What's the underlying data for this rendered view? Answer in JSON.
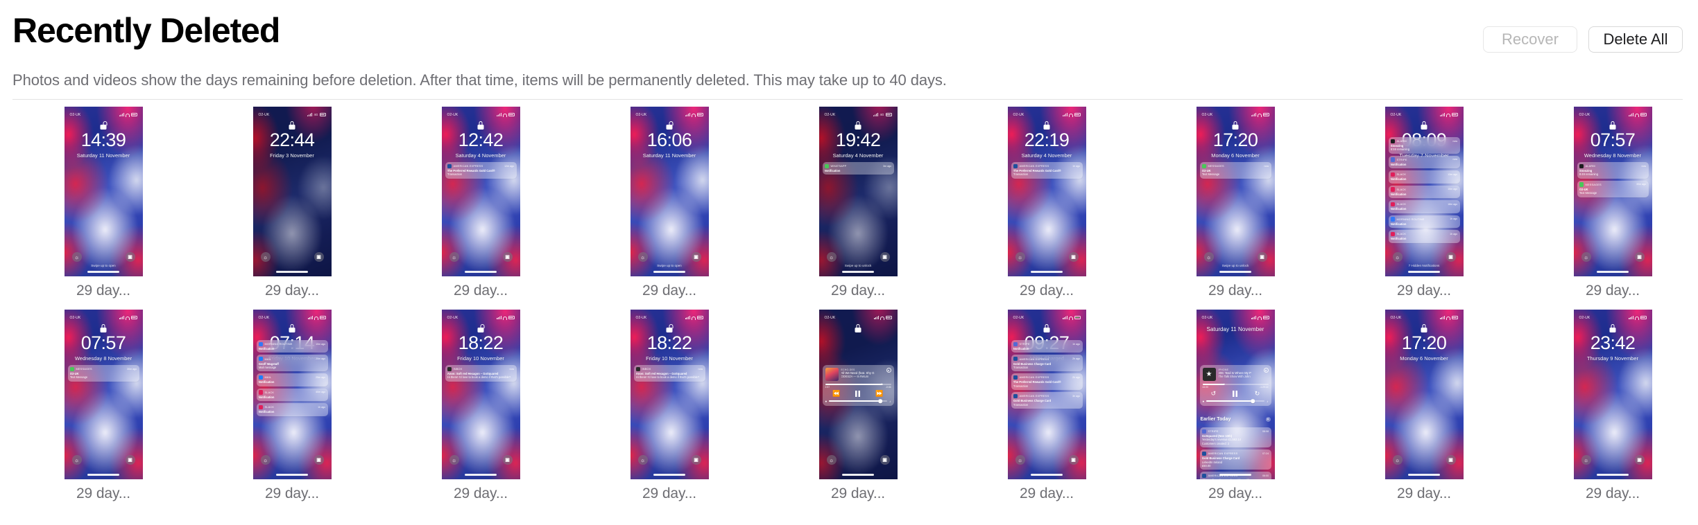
{
  "header": {
    "title": "Recently Deleted",
    "subtitle": "Photos and videos show the days remaining before deletion. After that time, items will be permanently deleted. This may take up to 40 days.",
    "recover_label": "Recover",
    "recover_disabled": true,
    "delete_all_label": "Delete All"
  },
  "colors": {
    "title": "#000000",
    "subtitle": "#6e6e73",
    "button_border": "#d8d8d8",
    "button_disabled_text": "#b6b6b6",
    "divider": "#e2e2e2",
    "caption": "#6e6e73",
    "background": "#ffffff"
  },
  "grid": {
    "columns": 9,
    "rows": 2,
    "items": [
      {
        "caption": "29 day...",
        "carrier": "O2-UK",
        "signal": "bars",
        "network": "wifi",
        "battery": "full",
        "time": "14:39",
        "date": "Saturday 11 November",
        "lock": "unlocked",
        "theme": "light",
        "swipe_hint": "Swipe up to open",
        "notifications": []
      },
      {
        "caption": "29 day...",
        "carrier": "O2-UK",
        "signal": "bars",
        "network": "4G",
        "battery": "full",
        "time": "22:44",
        "date": "Friday 3 November",
        "lock": "locked",
        "theme": "dark",
        "swipe_hint": "",
        "notifications": []
      },
      {
        "caption": "29 day...",
        "carrier": "O2-UK",
        "signal": "bars",
        "network": "wifi",
        "battery": "full",
        "time": "12:42",
        "date": "Saturday 4 November",
        "lock": "locked",
        "theme": "light",
        "swipe_hint": "",
        "notifications": [
          {
            "app": "AMERICAN EXPRESS",
            "ago": "12m ago",
            "line1": "The Preferred Rewards Gold Card®",
            "line2": "Transaction",
            "icon_color": "#1e4f9c"
          }
        ]
      },
      {
        "caption": "29 day...",
        "carrier": "O2-UK",
        "signal": "bars",
        "network": "wifi",
        "battery": "full",
        "time": "16:06",
        "date": "Saturday 11 November",
        "lock": "unlocked",
        "theme": "light",
        "swipe_hint": "Swipe up to open",
        "notifications": []
      },
      {
        "caption": "29 day...",
        "carrier": "O2-UK",
        "signal": "bars",
        "network": "4G",
        "battery": "full",
        "time": "19:42",
        "date": "Saturday 4 November",
        "lock": "locked",
        "theme": "dark",
        "swipe_hint": "Swipe up to unlock",
        "notifications": [
          {
            "app": "WHATSAPP",
            "ago": "3m ago",
            "line1": "Notification",
            "line2": "",
            "icon_color": "#4ac759"
          }
        ]
      },
      {
        "caption": "29 day...",
        "carrier": "O2-UK",
        "signal": "bars",
        "network": "wifi",
        "battery": "full",
        "time": "22:19",
        "date": "Saturday 4 November",
        "lock": "locked",
        "theme": "light",
        "swipe_hint": "",
        "notifications": [
          {
            "app": "AMERICAN EXPRESS",
            "ago": "1h ago",
            "line1": "The Preferred Rewards Gold Card®",
            "line2": "Transaction",
            "icon_color": "#1e4f9c"
          }
        ]
      },
      {
        "caption": "29 day...",
        "carrier": "O2-UK",
        "signal": "bars",
        "network": "wifi",
        "battery": "full",
        "time": "17:20",
        "date": "Monday 6 November",
        "lock": "locked",
        "theme": "light",
        "swipe_hint": "Swipe up to unlock",
        "notifications": [
          {
            "app": "MESSAGES",
            "ago": "now",
            "line1": "O2-UK",
            "line2": "Text Message",
            "icon_color": "#4ac759"
          }
        ]
      },
      {
        "caption": "29 day...",
        "carrier": "O2-UK",
        "signal": "bars",
        "network": "wifi",
        "battery": "full",
        "time": "08:09",
        "date": "Tuesday 7 November",
        "lock": "locked",
        "theme": "light",
        "swipe_hint": "7 Hidden Notifications",
        "notifications": [
          {
            "app": "ALARM",
            "ago": "now",
            "line1": "Snoozing",
            "line2": "8:59 remaining",
            "icon_color": "#1c1c1e"
          },
          {
            "app": "STRIPE",
            "ago": "now",
            "line1": "Notification",
            "line2": "",
            "icon_color": "#5469d4"
          },
          {
            "app": "SLACK",
            "ago": "13m ago",
            "line1": "Notification",
            "line2": "",
            "icon_color": "#e01e5a"
          },
          {
            "app": "SLACK",
            "ago": "15m ago",
            "line1": "Notification",
            "line2": "",
            "icon_color": "#e01e5a"
          },
          {
            "app": "SLACK",
            "ago": "18m ago",
            "line1": "Notification",
            "line2": "",
            "icon_color": "#e01e5a"
          },
          {
            "app": "MORNING ROUTINE",
            "ago": "1h ago",
            "line1": "Notification",
            "line2": "",
            "icon_color": "#3478f6"
          },
          {
            "app": "SLACK",
            "ago": "1h ago",
            "line1": "Notification",
            "line2": "",
            "icon_color": "#e01e5a"
          }
        ]
      },
      {
        "caption": "29 day...",
        "carrier": "O2-UK",
        "signal": "bars",
        "network": "wifi",
        "battery": "full",
        "time": "07:57",
        "date": "Wednesday 8 November",
        "lock": "locked",
        "theme": "light",
        "swipe_hint": "",
        "notifications": [
          {
            "app": "ALARM",
            "ago": "now",
            "line1": "Snoozing",
            "line2": "8:49 remaining",
            "icon_color": "#1c1c1e"
          },
          {
            "app": "MESSAGES",
            "ago": "30m ago",
            "line1": "O2-UK",
            "line2": "Text Message",
            "icon_color": "#4ac759"
          }
        ]
      },
      {
        "caption": "29 day...",
        "carrier": "O2-UK",
        "signal": "bars",
        "network": "wifi",
        "battery": "full",
        "time": "07:57",
        "date": "Wednesday 8 November",
        "lock": "locked",
        "theme": "light",
        "swipe_hint": "",
        "notifications": [
          {
            "app": "MESSAGES",
            "ago": "30m ago",
            "line1": "O2-UK",
            "line2": "Text Message",
            "icon_color": "#4ac759"
          }
        ]
      },
      {
        "caption": "29 day...",
        "carrier": "O2-UK",
        "signal": "bars",
        "network": "wifi",
        "battery": "full",
        "time": "07:14",
        "date": "Friday 10 November",
        "lock": "locked",
        "theme": "light",
        "swipe_hint": "",
        "notifications": [
          {
            "app": "MORNING ROUTINE",
            "ago": "10m ago",
            "line1": "Notification",
            "line2": "",
            "icon_color": "#3478f6"
          },
          {
            "app": "MAIL",
            "ago": "20m ago",
            "line1": "Geoff Wagstaff",
            "line2": "Mail message",
            "icon_color": "#1d7efd"
          },
          {
            "app": "MAIL",
            "ago": "25m ago",
            "line1": "Notification",
            "line2": "",
            "icon_color": "#1d7efd"
          },
          {
            "app": "SLACK",
            "ago": "40m ago",
            "line1": "Notification",
            "line2": "",
            "icon_color": "#e01e5a"
          },
          {
            "app": "SLACK",
            "ago": "1h ago",
            "line1": "Notification",
            "line2": "",
            "icon_color": "#e01e5a"
          }
        ]
      },
      {
        "caption": "29 day...",
        "carrier": "O2-UK",
        "signal": "bars",
        "network": "wifi",
        "battery": "full",
        "time": "18:22",
        "date": "Friday 10 November",
        "lock": "unlocked",
        "theme": "light",
        "swipe_hint": "",
        "notifications": [
          {
            "app": "INBOX",
            "ago": "now",
            "line1": "Anon: Soft red Hexagon – GoSquared",
            "line2": "Hi there! I'd love to book a demo if that's possible?",
            "icon_color": "#2b2b2b"
          }
        ]
      },
      {
        "caption": "29 day...",
        "carrier": "O2-UK",
        "signal": "bars",
        "network": "wifi",
        "battery": "full",
        "time": "18:22",
        "date": "Friday 10 November",
        "lock": "unlocked",
        "theme": "light",
        "swipe_hint": "",
        "notifications": [
          {
            "app": "INBOX",
            "ago": "now",
            "line1": "Anon: Soft red Hexagon – GoSquared",
            "line2": "Hi there! I'd love to book a demo if that's possible?",
            "icon_color": "#2b2b2b"
          }
        ]
      },
      {
        "caption": "29 day...",
        "carrier": "O2-UK",
        "signal": "bars",
        "network": "wifi",
        "battery": "full",
        "time": "",
        "date": "",
        "lock": "locked",
        "theme": "dark",
        "swipe_hint": "",
        "now_playing": {
          "source": "ECHO-DES",
          "title": "All We Need (feat. Shy G",
          "artist": "ODESZA — In Return",
          "elapsed": "2:57",
          "remaining": "-0:46",
          "progress": 86,
          "volume": 88,
          "state": "playing"
        },
        "notifications": []
      },
      {
        "caption": "29 day...",
        "carrier": "O2-UK",
        "signal": "bars",
        "network": "wifi",
        "battery": "charged",
        "time": "09:27",
        "date": "100% Charged",
        "lock": "locked",
        "theme": "light",
        "swipe_hint": "",
        "notifications": [
          {
            "app": "STRIPE",
            "ago": "1h ago",
            "line1": "Notification",
            "line2": "",
            "icon_color": "#5469d4"
          },
          {
            "app": "AMERICAN EXPRESS",
            "ago": "2h ago",
            "line1": "Gold Business Charge Card",
            "line2": "Transaction",
            "icon_color": "#1e4f9c"
          },
          {
            "app": "AMERICAN EXPRESS",
            "ago": "2h ago",
            "line1": "The Preferred Rewards Gold Card®",
            "line2": "Transaction",
            "icon_color": "#1e4f9c"
          },
          {
            "app": "AMERICAN EXPRESS",
            "ago": "3h ago",
            "line1": "Gold Business Charge Card",
            "line2": "Transaction",
            "icon_color": "#1e4f9c"
          }
        ]
      },
      {
        "caption": "29 day...",
        "carrier": "O2-UK",
        "signal": "bars",
        "network": "wifi",
        "battery": "full",
        "time": "",
        "date": "Saturday 11 November",
        "lock": "none",
        "theme": "light",
        "swipe_hint": "",
        "section_label": "Earlier Today",
        "now_playing": {
          "source": "iPhone",
          "title": "206: 'Bed Is Where My P",
          "artist": "The Talk Show With John",
          "elapsed": "44:00",
          "remaining": "-1:29:14",
          "progress": 33,
          "volume": 80,
          "state": "playing"
        },
        "notifications": [
          {
            "app": "STRIPE",
            "ago": "08:08",
            "line1": "GoSquared (Nov 10th)",
            "line2": "Yesterday's revenue £1,562.14",
            "line3": "Customers created: 2",
            "icon_color": "#5469d4"
          },
          {
            "app": "AMERICAN EXPRESS",
            "ago": "07:24",
            "line1": "Gold Business Charge Card",
            "line2": "LinkedIn Ireland",
            "line3": "£50.00",
            "icon_color": "#1e4f9c"
          },
          {
            "app": "AMERICAN EXPRESS",
            "ago": "06:00",
            "line1": "The Preferred Rewards Gold Card®",
            "line2": "iTunes.com/bill",
            "line3": "£10.49",
            "icon_color": "#1e4f9c"
          }
        ]
      },
      {
        "caption": "29 day...",
        "carrier": "O2-UK",
        "signal": "bars",
        "network": "wifi",
        "battery": "full",
        "time": "17:20",
        "date": "Monday 6 November",
        "lock": "locked",
        "theme": "light",
        "swipe_hint": "",
        "notifications": []
      },
      {
        "caption": "29 day...",
        "carrier": "O2-UK",
        "signal": "bars",
        "network": "wifi",
        "battery": "full",
        "time": "23:42",
        "date": "Thursday 9 November",
        "lock": "locked",
        "theme": "light",
        "swipe_hint": "",
        "notifications": []
      }
    ]
  }
}
